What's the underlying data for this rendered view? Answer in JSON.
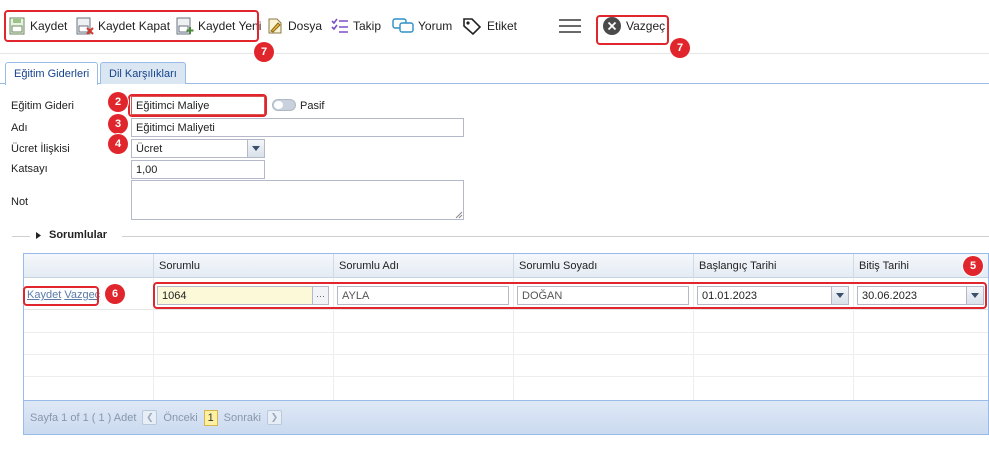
{
  "toolbar": {
    "save": "Kaydet",
    "save_close": "Kaydet Kapat",
    "save_new": "Kaydet Yeni",
    "file": "Dosya",
    "follow": "Takip",
    "comment": "Yorum",
    "tag": "Etiket",
    "cancel": "Vazgeç"
  },
  "tabs": [
    "Eğitim Giderleri",
    "Dil Karşılıkları"
  ],
  "form": {
    "expense_label": "Eğitim Gideri",
    "expense_value": "Eğitimci Maliye",
    "passive_label": "Pasif",
    "name_label": "Adı",
    "name_value": "Eğitimci Maliyeti",
    "fee_label": "Ücret İlişkisi",
    "fee_value": "Ücret",
    "coef_label": "Katsayı",
    "coef_value": "1,00",
    "note_label": "Not",
    "note_value": ""
  },
  "section": {
    "title": "Sorumlular"
  },
  "grid": {
    "columns": [
      "Sorumlu",
      "Sorumlu Adı",
      "Sorumlu Soyadı",
      "Başlangıç Tarihi",
      "Bitiş Tarihi"
    ],
    "edit_row": {
      "save_link": "Kaydet",
      "cancel_link": "Vazgeç",
      "code": "1064",
      "first_name": "AYLA",
      "last_name": "DOĞAN",
      "start_date": "01.01.2023",
      "end_date": "30.06.2023"
    }
  },
  "pager": {
    "summary": "Sayfa 1 of 1 ( 1 ) Adet",
    "prev": "Önceki",
    "page": "1",
    "next": "Sonraki"
  },
  "badges": {
    "b2": "2",
    "b3": "3",
    "b4": "4",
    "b5": "5",
    "b6": "6",
    "b7a": "7",
    "b7b": "7"
  },
  "colors": {
    "annotation": "#e0262c",
    "accent": "#15428b"
  }
}
